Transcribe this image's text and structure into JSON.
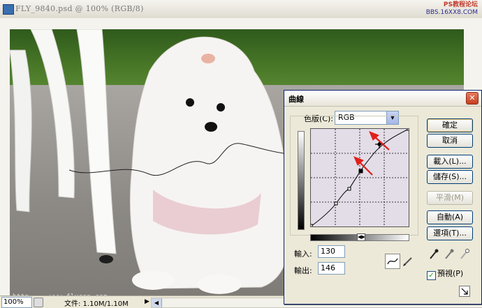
{
  "document": {
    "title": "FLY_9840.psd @ 100% (RGB/8)",
    "watermark_line1": "PS教程论坛",
    "watermark_line2": "BBS.16XX8.COM",
    "canvas_caption": "http ... www.flycan.com",
    "status": {
      "zoom": "100%",
      "doc_size": "文件: 1.10M/1.10M"
    }
  },
  "curves_dialog": {
    "title": "曲線",
    "channel_label": "色版(C):",
    "channel_value": "RGB",
    "input_label": "輸入:",
    "input_value": "130",
    "output_label": "輸出:",
    "output_value": "146",
    "buttons": {
      "ok": "確定",
      "cancel": "取消",
      "load": "載入(L)...",
      "save": "儲存(S)...",
      "smooth": "平滑(M)",
      "auto": "自動(A)",
      "options": "選項(T)..."
    },
    "preview_label": "預視(P)",
    "preview_checked": true
  },
  "colors": {
    "title_bar_close": "#c4401f",
    "curve_line": "#000000",
    "annotation_arrow": "#e0201c",
    "plot_background": "#e3dde8"
  }
}
